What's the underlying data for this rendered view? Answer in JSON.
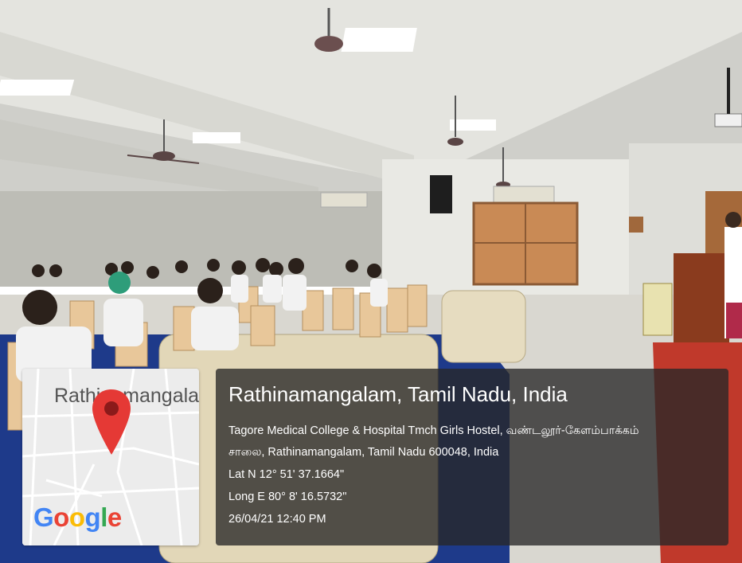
{
  "map": {
    "place_label": "Rathinamangalam",
    "logo_text": "Google",
    "logo_colors": [
      "#4285F4",
      "#EA4335",
      "#FBBC05",
      "#4285F4",
      "#34A853",
      "#EA4335"
    ]
  },
  "location": {
    "title": "Rathinamangalam, Tamil Nadu, India",
    "address_line_1": "Tagore Medical College & Hospital Tmch Girls Hostel, வண்டலூர்-கேளம்பாக்கம்",
    "address_line_2": "சாலை, Rathinamangalam, Tamil Nadu 600048, India",
    "latitude": "Lat N 12° 51' 37.1664\"",
    "longitude": "Long E 80° 8' 16.5732\"",
    "timestamp": "26/04/21 12:40 PM"
  },
  "colors": {
    "pin": "#e53935",
    "overlay": "#282828",
    "carpet_blue": "#1e3a8a",
    "stage_red": "#c0392b"
  }
}
